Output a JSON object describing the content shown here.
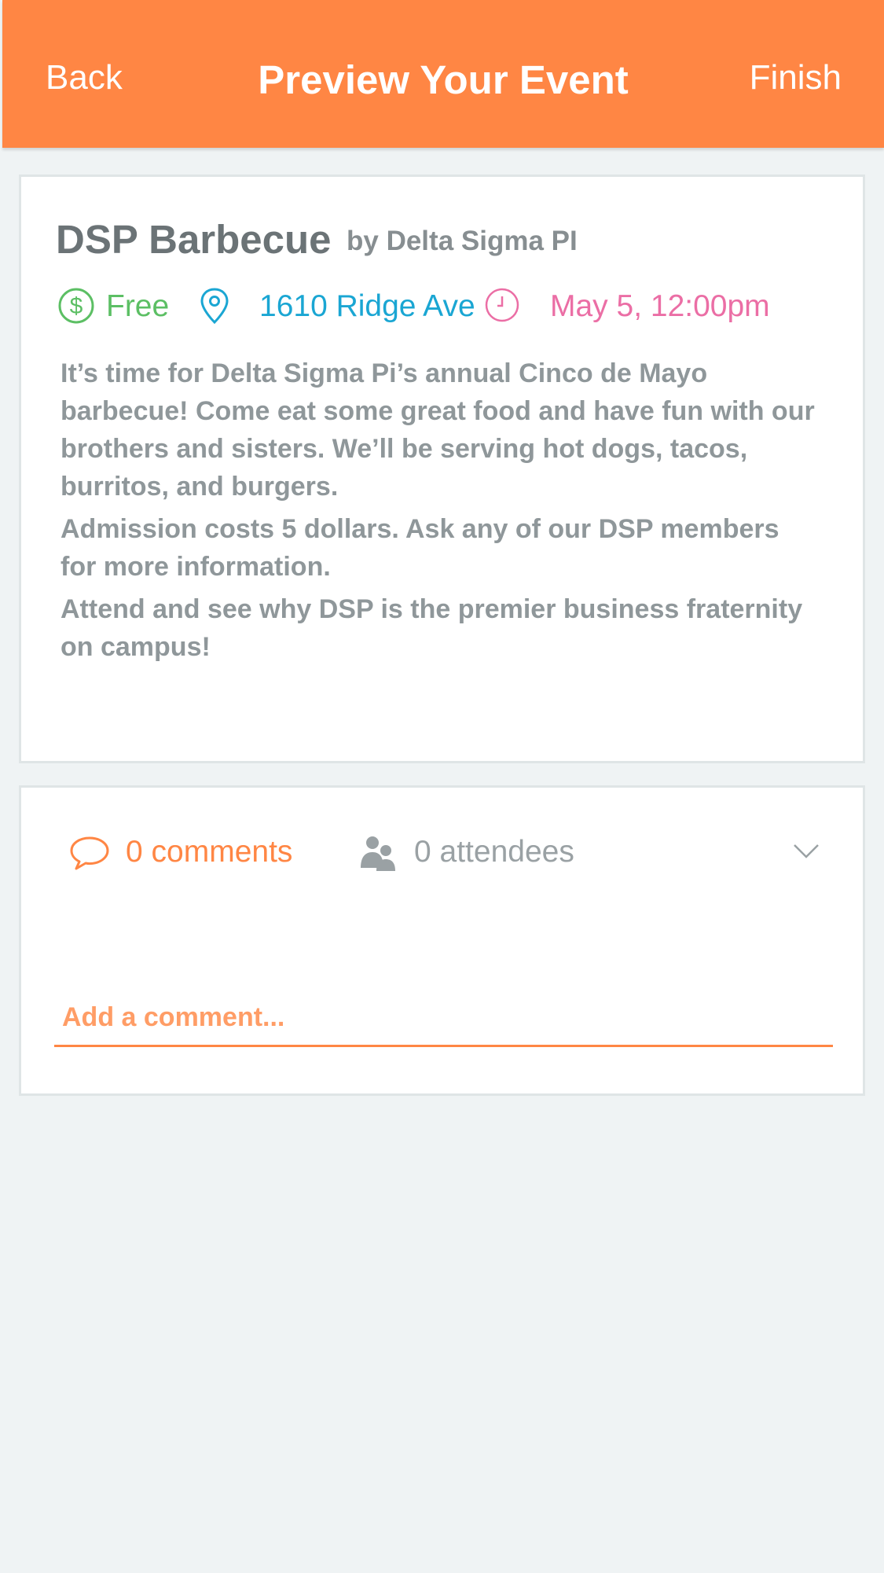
{
  "header": {
    "back_label": "Back",
    "title": "Preview Your Event",
    "finish_label": "Finish"
  },
  "event": {
    "title": "DSP Barbecue",
    "by": "by Delta Sigma PI",
    "price": "Free",
    "location": "1610 Ridge Ave",
    "datetime": "May 5, 12:00pm",
    "description": [
      "It’s time for Delta Sigma Pi’s annual Cinco de Mayo barbecue! Come eat some great food and have fun with our brothers and sisters. We’ll be serving hot dogs, tacos, burritos, and burgers.",
      "Admission costs 5 dollars. Ask any of our DSP members for more information.",
      "Attend and see why DSP is the premier business fraternity on campus!"
    ]
  },
  "social": {
    "comments_label": "0 comments",
    "attendees_label": "0 attendees",
    "comment_placeholder": "Add a comment..."
  },
  "colors": {
    "accent": "#ff8644",
    "price": "#5cbf64",
    "location": "#1aa6d3",
    "time": "#eb6ea5"
  },
  "icons": {
    "price": "dollar-circle-icon",
    "location": "map-pin-icon",
    "time": "clock-icon",
    "comments": "speech-bubble-icon",
    "attendees": "people-icon",
    "expand": "chevron-down-icon"
  }
}
